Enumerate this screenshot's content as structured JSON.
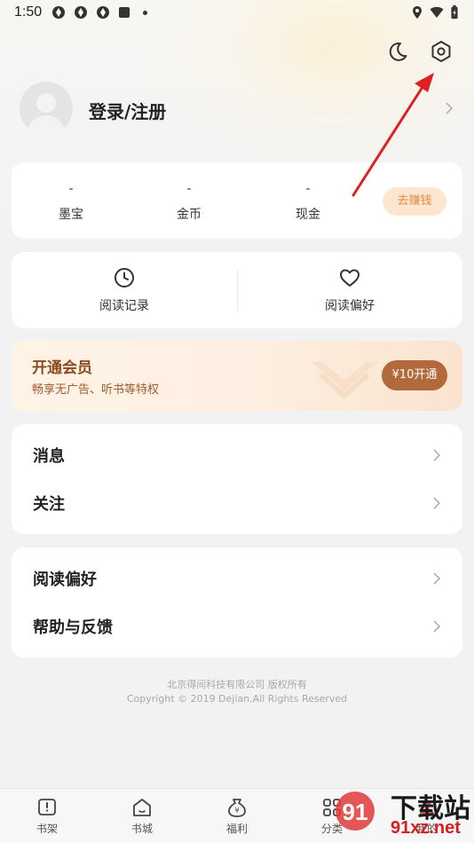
{
  "status_bar": {
    "time": "1:50"
  },
  "profile": {
    "login_label": "登录/注册"
  },
  "stats": [
    {
      "value": "-",
      "label": "墨宝"
    },
    {
      "value": "-",
      "label": "金币"
    },
    {
      "value": "-",
      "label": "现金"
    }
  ],
  "earn_button": "去赚钱",
  "quick_links": [
    {
      "label": "阅读记录",
      "icon": "clock-icon"
    },
    {
      "label": "阅读偏好",
      "icon": "heart-icon"
    }
  ],
  "vip": {
    "title": "开通会员",
    "subtitle": "畅享无广告、听书等特权",
    "button": "¥10开通"
  },
  "menu_group_1": [
    {
      "label": "消息"
    },
    {
      "label": "关注"
    }
  ],
  "menu_group_2": [
    {
      "label": "阅读偏好"
    },
    {
      "label": "帮助与反馈"
    }
  ],
  "footer": {
    "company": "北京得间科技有限公司  版权所有",
    "copyright": "Copyright © 2019 Dejian.All Rights Reserved"
  },
  "tabs": [
    {
      "label": "书架",
      "icon": "bookshelf-icon"
    },
    {
      "label": "书城",
      "icon": "home-icon"
    },
    {
      "label": "福利",
      "icon": "money-bag-icon"
    },
    {
      "label": "分类",
      "icon": "grid-icon"
    },
    {
      "label": "我的",
      "icon": "user-icon"
    }
  ],
  "watermark": {
    "line1": "下载站",
    "line2": "91xz.net"
  },
  "colors": {
    "accent_orange": "#e58a3d",
    "vip_brown": "#b26a3c",
    "arrow_red": "#e02020"
  }
}
